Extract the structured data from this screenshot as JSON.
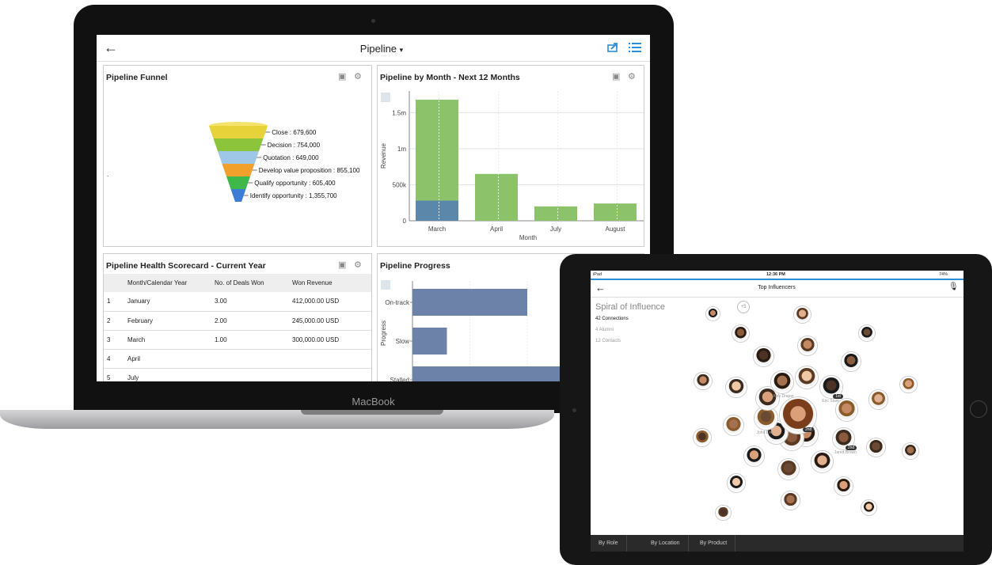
{
  "laptop": {
    "brand": "MacBook",
    "header": {
      "title": "Pipeline",
      "title_caret": "▾"
    },
    "funnel": {
      "title": "Pipeline Funnel",
      "stages": [
        {
          "label": "Close : 679,600",
          "color": "#e8d23a"
        },
        {
          "label": "Decision : 754,000",
          "color": "#8cc43c"
        },
        {
          "label": "Quotation : 649,000",
          "color": "#9ec6e6"
        },
        {
          "label": "Develop value proposition : 855,100",
          "color": "#f2a02c"
        },
        {
          "label": "Qualify opportunity : 605,400",
          "color": "#3fb84a"
        },
        {
          "label": "Identify opportunity : 1,355,700",
          "color": "#3c7cd6"
        }
      ]
    },
    "bymonth": {
      "title": "Pipeline by Month - Next 12 Months",
      "chart_data": {
        "type": "bar",
        "categories": [
          "March",
          "April",
          "July",
          "August"
        ],
        "series": [
          {
            "values": [
              280000,
              0,
              0,
              0
            ],
            "color": "#5b87ab"
          },
          {
            "values": [
              1400000,
              650000,
              200000,
              240000
            ],
            "color": "#8cc36a"
          }
        ],
        "xlabel": "Month",
        "ylabel": "Revenue",
        "yticks": [
          "0",
          "500k",
          "1m",
          "1.5m"
        ],
        "ylim": [
          0,
          1800000
        ],
        "grid": true
      }
    },
    "scorecard": {
      "title": "Pipeline Health Scorecard - Current Year",
      "columns": [
        "Month/Calendar Year",
        "No. of Deals Won",
        "Won Revenue"
      ],
      "rows": [
        {
          "n": "1",
          "month": "January",
          "deals": "3.00",
          "rev": "412,000.00 USD"
        },
        {
          "n": "2",
          "month": "February",
          "deals": "2.00",
          "rev": "245,000.00 USD"
        },
        {
          "n": "3",
          "month": "March",
          "deals": "1.00",
          "rev": "300,000.00 USD"
        },
        {
          "n": "4",
          "month": "April",
          "deals": "",
          "rev": ""
        },
        {
          "n": "5",
          "month": "July",
          "deals": "",
          "rev": ""
        }
      ]
    },
    "progress": {
      "title": "Pipeline Progress",
      "chart_data": {
        "type": "bar",
        "orientation": "horizontal",
        "categories": [
          "On-track",
          "Slow",
          "Stalled"
        ],
        "values": [
          1.0,
          0.3,
          1.4
        ],
        "ylabel": "Progress",
        "color": "#6c82a8"
      }
    }
  },
  "tablet": {
    "status": {
      "carrier": "iPad",
      "time": "12:36 PM",
      "battery": "74%"
    },
    "nav_title": "Top Influencers",
    "heading": "Spiral of Influence",
    "stats": [
      "42 Connections",
      "4 Alumni",
      "12 Contacts"
    ],
    "more_badge": "+5",
    "named": [
      {
        "name": "John Lim"
      },
      {
        "name": "Alex Draper"
      },
      {
        "name": "Eric Stark",
        "badge": "1st"
      },
      {
        "name": "Jared Brown",
        "badge": "2nd"
      },
      {
        "name": "Mark Taylor",
        "badge": "1st"
      }
    ],
    "center_badge": "2nd",
    "tabs": [
      "By Role",
      "By Location",
      "By Product"
    ]
  },
  "colors": {
    "accent": "#2b8ed6",
    "funnel_link": "#2d7fd0"
  }
}
